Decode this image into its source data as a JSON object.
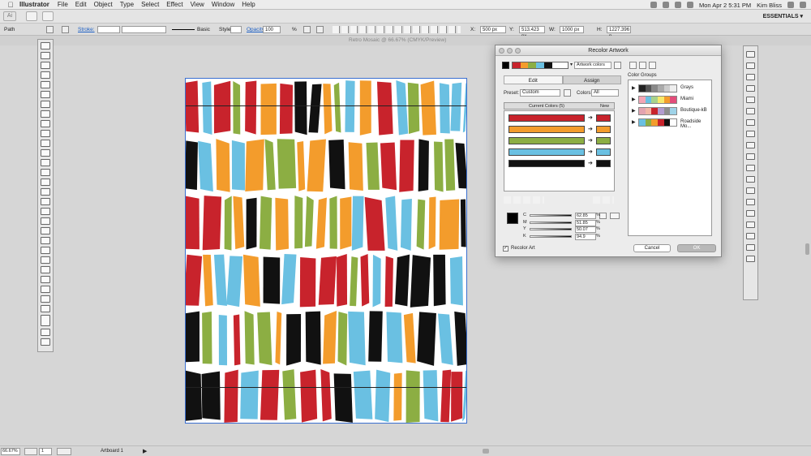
{
  "menubar": {
    "app": "Illustrator",
    "items": [
      "File",
      "Edit",
      "Object",
      "Type",
      "Select",
      "Effect",
      "View",
      "Window",
      "Help"
    ],
    "datetime": "Mon Apr 2  5:31 PM",
    "user": "Kim Bliss"
  },
  "appbar": {
    "logo": "Ai",
    "workspace": "ESSENTIALS ▾"
  },
  "controlbar": {
    "selection": "Path",
    "stroke_label": "Stroke:",
    "brush": "Basic",
    "style_label": "Style:",
    "opacity_label": "Opacity:",
    "opacity_value": "100",
    "opacity_unit": "%",
    "x_label": "X:",
    "x_value": "500 px",
    "y_label": "Y:",
    "y_value": "513.423 px",
    "w_label": "W:",
    "w_value": "1000 px",
    "h_label": "H:",
    "h_value": "1227.396 p"
  },
  "document": {
    "title": "Retro Mosaic @ 66.67% (CMYK/Preview)"
  },
  "dialog": {
    "title": "Recolor Artwork",
    "artwork_colors": "Artwork colors",
    "tabs": [
      "Edit",
      "Assign"
    ],
    "preset_label": "Preset:",
    "preset_value": "Custom",
    "colors_label": "Colors:",
    "colors_value": "All",
    "current_colors": "Current Colors (5)",
    "new_label": "New",
    "rows": [
      {
        "color": "#c8232c"
      },
      {
        "color": "#f39c2c"
      },
      {
        "color": "#8cae43"
      },
      {
        "color": "#6ac0e2"
      },
      {
        "color": "#111111"
      }
    ],
    "sliders": [
      {
        "label": "C",
        "value": "62.85",
        "unit": "%"
      },
      {
        "label": "M",
        "value": "51.85",
        "unit": "%"
      },
      {
        "label": "Y",
        "value": "50.07",
        "unit": "%"
      },
      {
        "label": "K",
        "value": "94.9",
        "unit": "%"
      }
    ],
    "color_groups_label": "Color Groups",
    "color_groups": [
      {
        "name": "Grays",
        "colors": [
          "#222222",
          "#555555",
          "#888888",
          "#aaaaaa",
          "#cccccc",
          "#eeeeee"
        ]
      },
      {
        "name": "Miami",
        "colors": [
          "#f3a5b5",
          "#6ac0e2",
          "#a7d28c",
          "#f7e96b",
          "#f39c2c",
          "#e34d7a"
        ]
      },
      {
        "name": "Boutique-kB",
        "colors": [
          "#e3a3b0",
          "#f3b6a6",
          "#c8232c",
          "#b39cd0",
          "#8e8e8e",
          "#9fd3e8"
        ]
      },
      {
        "name": "Roadside Mo...",
        "colors": [
          "#6ac0e2",
          "#8cae43",
          "#f39c2c",
          "#c8232c",
          "#111111",
          "#ffffff"
        ]
      }
    ],
    "recolor_art": "Recolor Art",
    "cancel": "Cancel",
    "ok": "OK"
  },
  "statusbar": {
    "zoom": "66.67%",
    "page": "1",
    "artboard_label": "Artboard 1"
  },
  "artwork": {
    "palette": [
      "#c8232c",
      "#f39c2c",
      "#8cae43",
      "#6ac0e2",
      "#111111"
    ]
  }
}
